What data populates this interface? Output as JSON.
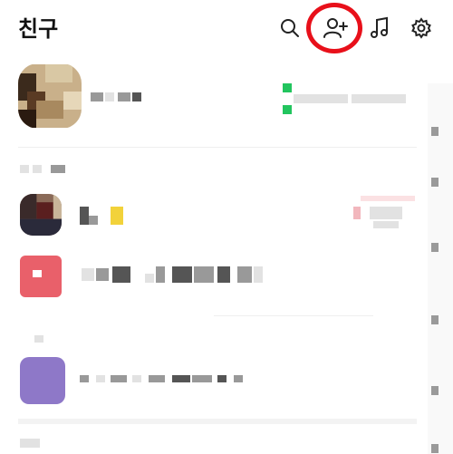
{
  "header": {
    "title": "친구",
    "icons": [
      "search-icon",
      "add-friend-icon",
      "music-icon",
      "settings-icon"
    ]
  },
  "colors": {
    "highlight": "#e8101a",
    "online_green": "#22c55e",
    "avatar_red": "#e9606a",
    "avatar_purple": "#8e78c8"
  }
}
